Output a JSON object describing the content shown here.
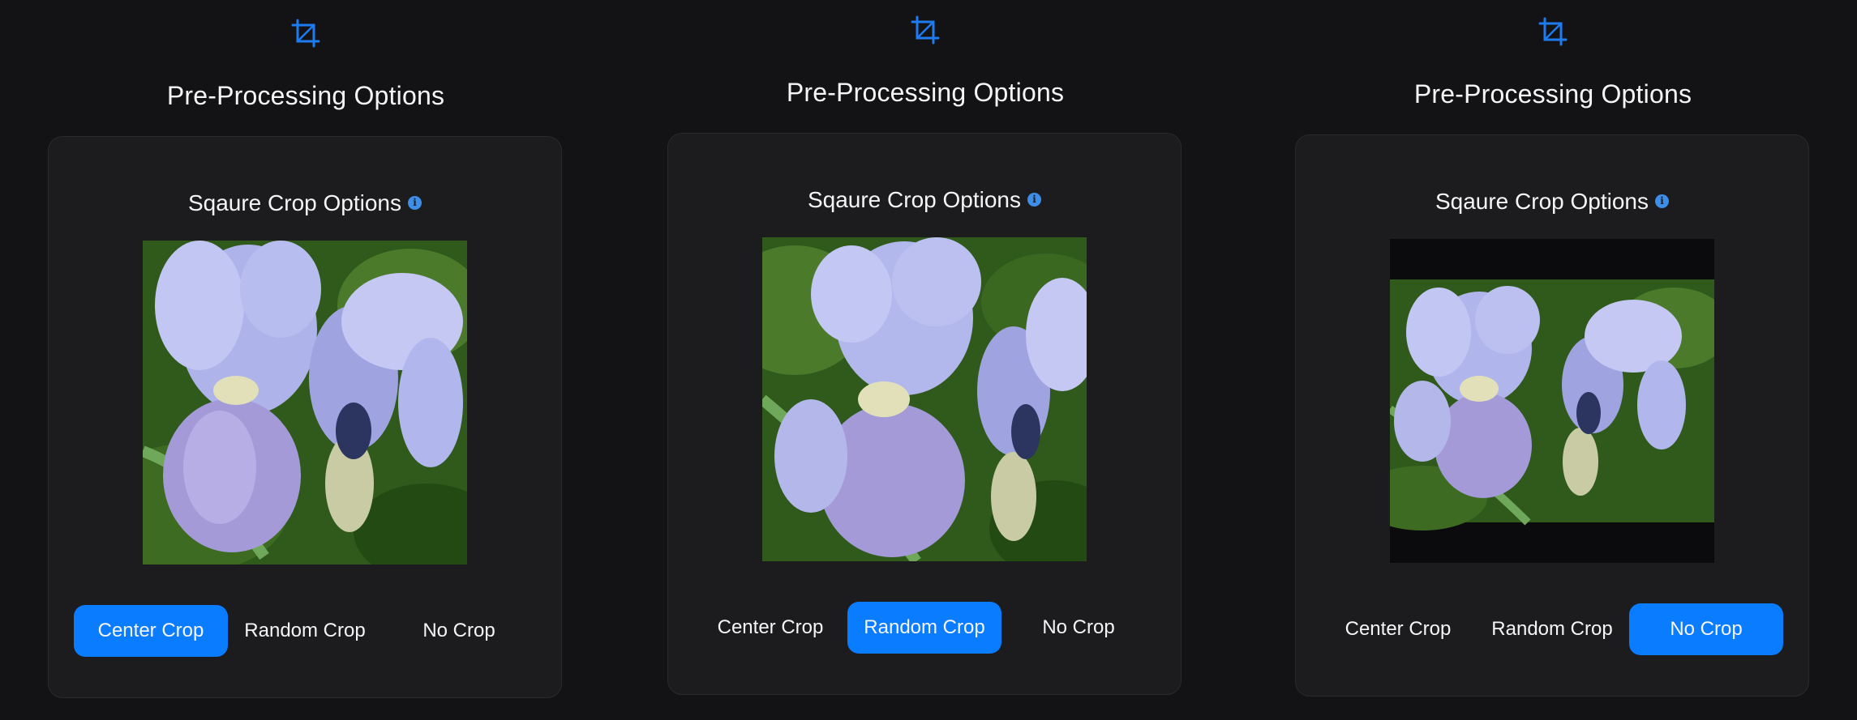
{
  "colors": {
    "background": "#131316",
    "card": "#1c1c1e",
    "accent": "#0a7cff",
    "info_icon": "#3d8ee8",
    "crop_icon": "#1e7bf0"
  },
  "panels": [
    {
      "icon": "crop-icon",
      "section_title": "Pre-Processing Options",
      "card_title": "Sqaure Crop Options",
      "info_icon": "info-icon",
      "preview_mode": "center-crop",
      "buttons": [
        {
          "label": "Center Crop",
          "active": true
        },
        {
          "label": "Random Crop",
          "active": false
        },
        {
          "label": "No Crop",
          "active": false
        }
      ]
    },
    {
      "icon": "crop-icon",
      "section_title": "Pre-Processing Options",
      "card_title": "Sqaure Crop Options",
      "info_icon": "info-icon",
      "preview_mode": "random-crop",
      "buttons": [
        {
          "label": "Center Crop",
          "active": false
        },
        {
          "label": "Random Crop",
          "active": true
        },
        {
          "label": "No Crop",
          "active": false
        }
      ]
    },
    {
      "icon": "crop-icon",
      "section_title": "Pre-Processing Options",
      "card_title": "Sqaure Crop Options",
      "info_icon": "info-icon",
      "preview_mode": "no-crop",
      "buttons": [
        {
          "label": "Center Crop",
          "active": false
        },
        {
          "label": "Random Crop",
          "active": false
        },
        {
          "label": "No Crop",
          "active": true
        }
      ]
    }
  ]
}
